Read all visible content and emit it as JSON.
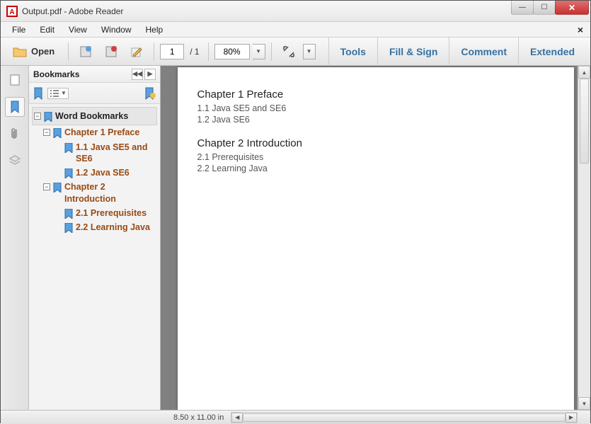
{
  "window": {
    "title": "Output.pdf - Adobe Reader"
  },
  "menu": {
    "file": "File",
    "edit": "Edit",
    "view": "View",
    "window": "Window",
    "help": "Help"
  },
  "toolbar": {
    "open": "Open",
    "page_current": "1",
    "page_total": "/ 1",
    "zoom": "80%"
  },
  "right_tools": {
    "tools": "Tools",
    "fill": "Fill & Sign",
    "comment": "Comment",
    "extended": "Extended"
  },
  "panel": {
    "title": "Bookmarks"
  },
  "tree": {
    "root": "Word Bookmarks",
    "c1": "Chapter 1 Preface",
    "c1_1": "1.1 Java SE5 and SE6",
    "c1_2": "1.2 Java SE6",
    "c2": "Chapter 2 Introduction",
    "c2_1": "2.1 Prerequisites",
    "c2_2": "2.2 Learning Java"
  },
  "doc": {
    "h1": "Chapter 1 Preface",
    "l1": "1.1 Java SE5 and SE6",
    "l2": "1.2 Java SE6",
    "h2": "Chapter 2 Introduction",
    "l3": "2.1 Prerequisites",
    "l4": "2.2 Learning Java"
  },
  "status": {
    "dims": "8.50 x 11.00 in"
  }
}
